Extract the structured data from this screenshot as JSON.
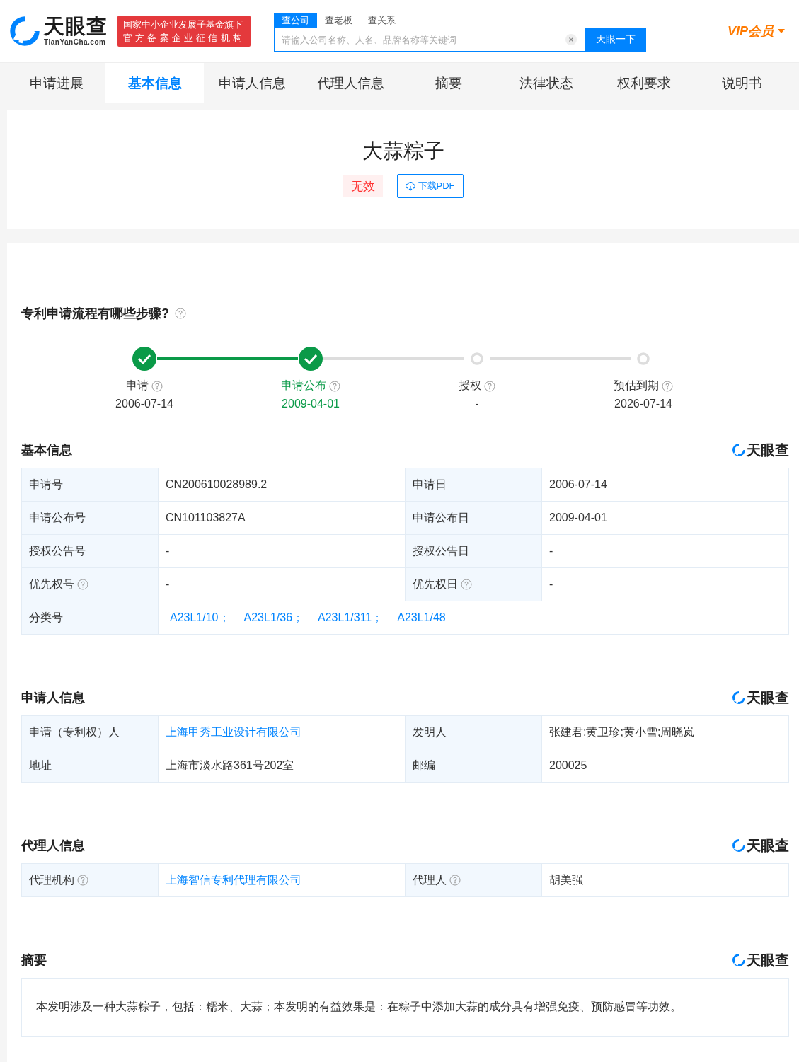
{
  "header": {
    "logo": {
      "name": "天眼查",
      "domain": "TianYanCha.com"
    },
    "badge": [
      "国家中小企业发展子基金旗下",
      "官方备案企业征信机构"
    ],
    "search_tabs": [
      {
        "label": "查公司",
        "selected": true
      },
      {
        "label": "查老板",
        "selected": false
      },
      {
        "label": "查关系",
        "selected": false
      }
    ],
    "search": {
      "placeholder": "请输入公司名称、人名、品牌名称等关键词",
      "button": "天眼一下"
    },
    "vip": "VIP会员"
  },
  "nav": [
    {
      "label": "申请进展",
      "selected": false
    },
    {
      "label": "基本信息",
      "selected": true
    },
    {
      "label": "申请人信息",
      "selected": false
    },
    {
      "label": "代理人信息",
      "selected": false
    },
    {
      "label": "摘要",
      "selected": false
    },
    {
      "label": "法律状态",
      "selected": false
    },
    {
      "label": "权利要求",
      "selected": false
    },
    {
      "label": "说明书",
      "selected": false
    }
  ],
  "patent": {
    "title": "大蒜粽子",
    "status": "无效",
    "download": "下载PDF"
  },
  "process": {
    "title": "专利申请流程有哪些步骤?",
    "steps": [
      {
        "label": "申请",
        "date": "2006-07-14",
        "done": true,
        "selected": false
      },
      {
        "label": "申请公布",
        "date": "2009-04-01",
        "done": true,
        "selected": true
      },
      {
        "label": "授权",
        "date": "-",
        "done": false,
        "selected": false
      },
      {
        "label": "预估到期",
        "date": "2026-07-14",
        "done": false,
        "selected": false
      }
    ]
  },
  "sections": [
    {
      "kind": "table",
      "title": "基本信息",
      "brand": "天眼查",
      "rows": [
        [
          {
            "text": "申请号",
            "help": false
          },
          {
            "text": "CN200610028989.2",
            "link": false
          },
          {
            "text": "申请日",
            "help": false
          },
          {
            "text": "2006-07-14",
            "link": false
          }
        ],
        [
          {
            "text": "申请公布号",
            "help": false
          },
          {
            "text": "CN101103827A",
            "link": false
          },
          {
            "text": "申请公布日",
            "help": false
          },
          {
            "text": "2009-04-01",
            "link": false
          }
        ],
        [
          {
            "text": "授权公告号",
            "help": false
          },
          {
            "text": "-",
            "link": false
          },
          {
            "text": "授权公告日",
            "help": false
          },
          {
            "text": "-",
            "link": false
          }
        ],
        [
          {
            "text": "优先权号",
            "help": true
          },
          {
            "text": "-",
            "link": false
          },
          {
            "text": "优先权日",
            "help": true
          },
          {
            "text": "-",
            "link": false
          }
        ],
        [
          {
            "text": "分类号",
            "help": false
          },
          {
            "links": [
              "A23L1/10；",
              "A23L1/36；",
              "A23L1/311；",
              "A23L1/48"
            ]
          }
        ]
      ]
    },
    {
      "kind": "table",
      "title": "申请人信息",
      "brand": "天眼查",
      "rows": [
        [
          {
            "text": "申请（专利权）人",
            "help": false
          },
          {
            "text": "上海甲秀工业设计有限公司",
            "link": true
          },
          {
            "text": "发明人",
            "help": false
          },
          {
            "text": "张建君;黄卫珍;黄小雪;周晓岚",
            "link": false
          }
        ],
        [
          {
            "text": "地址",
            "help": false
          },
          {
            "text": "上海市淡水路361号202室",
            "link": false
          },
          {
            "text": "邮编",
            "help": false
          },
          {
            "text": "200025",
            "link": false
          }
        ]
      ]
    },
    {
      "kind": "table",
      "title": "代理人信息",
      "brand": "天眼查",
      "rows": [
        [
          {
            "text": "代理机构",
            "help": true
          },
          {
            "text": "上海智信专利代理有限公司",
            "link": true
          },
          {
            "text": "代理人",
            "help": true
          },
          {
            "text": "胡美强",
            "link": false
          }
        ]
      ]
    },
    {
      "kind": "text",
      "title": "摘要",
      "brand": "天眼查",
      "text": "本发明涉及一种大蒜粽子，包括：糯米、大蒜；本发明的有益效果是：在粽子中添加大蒜的成分具有增强免疫、预防感冒等功效。"
    }
  ]
}
